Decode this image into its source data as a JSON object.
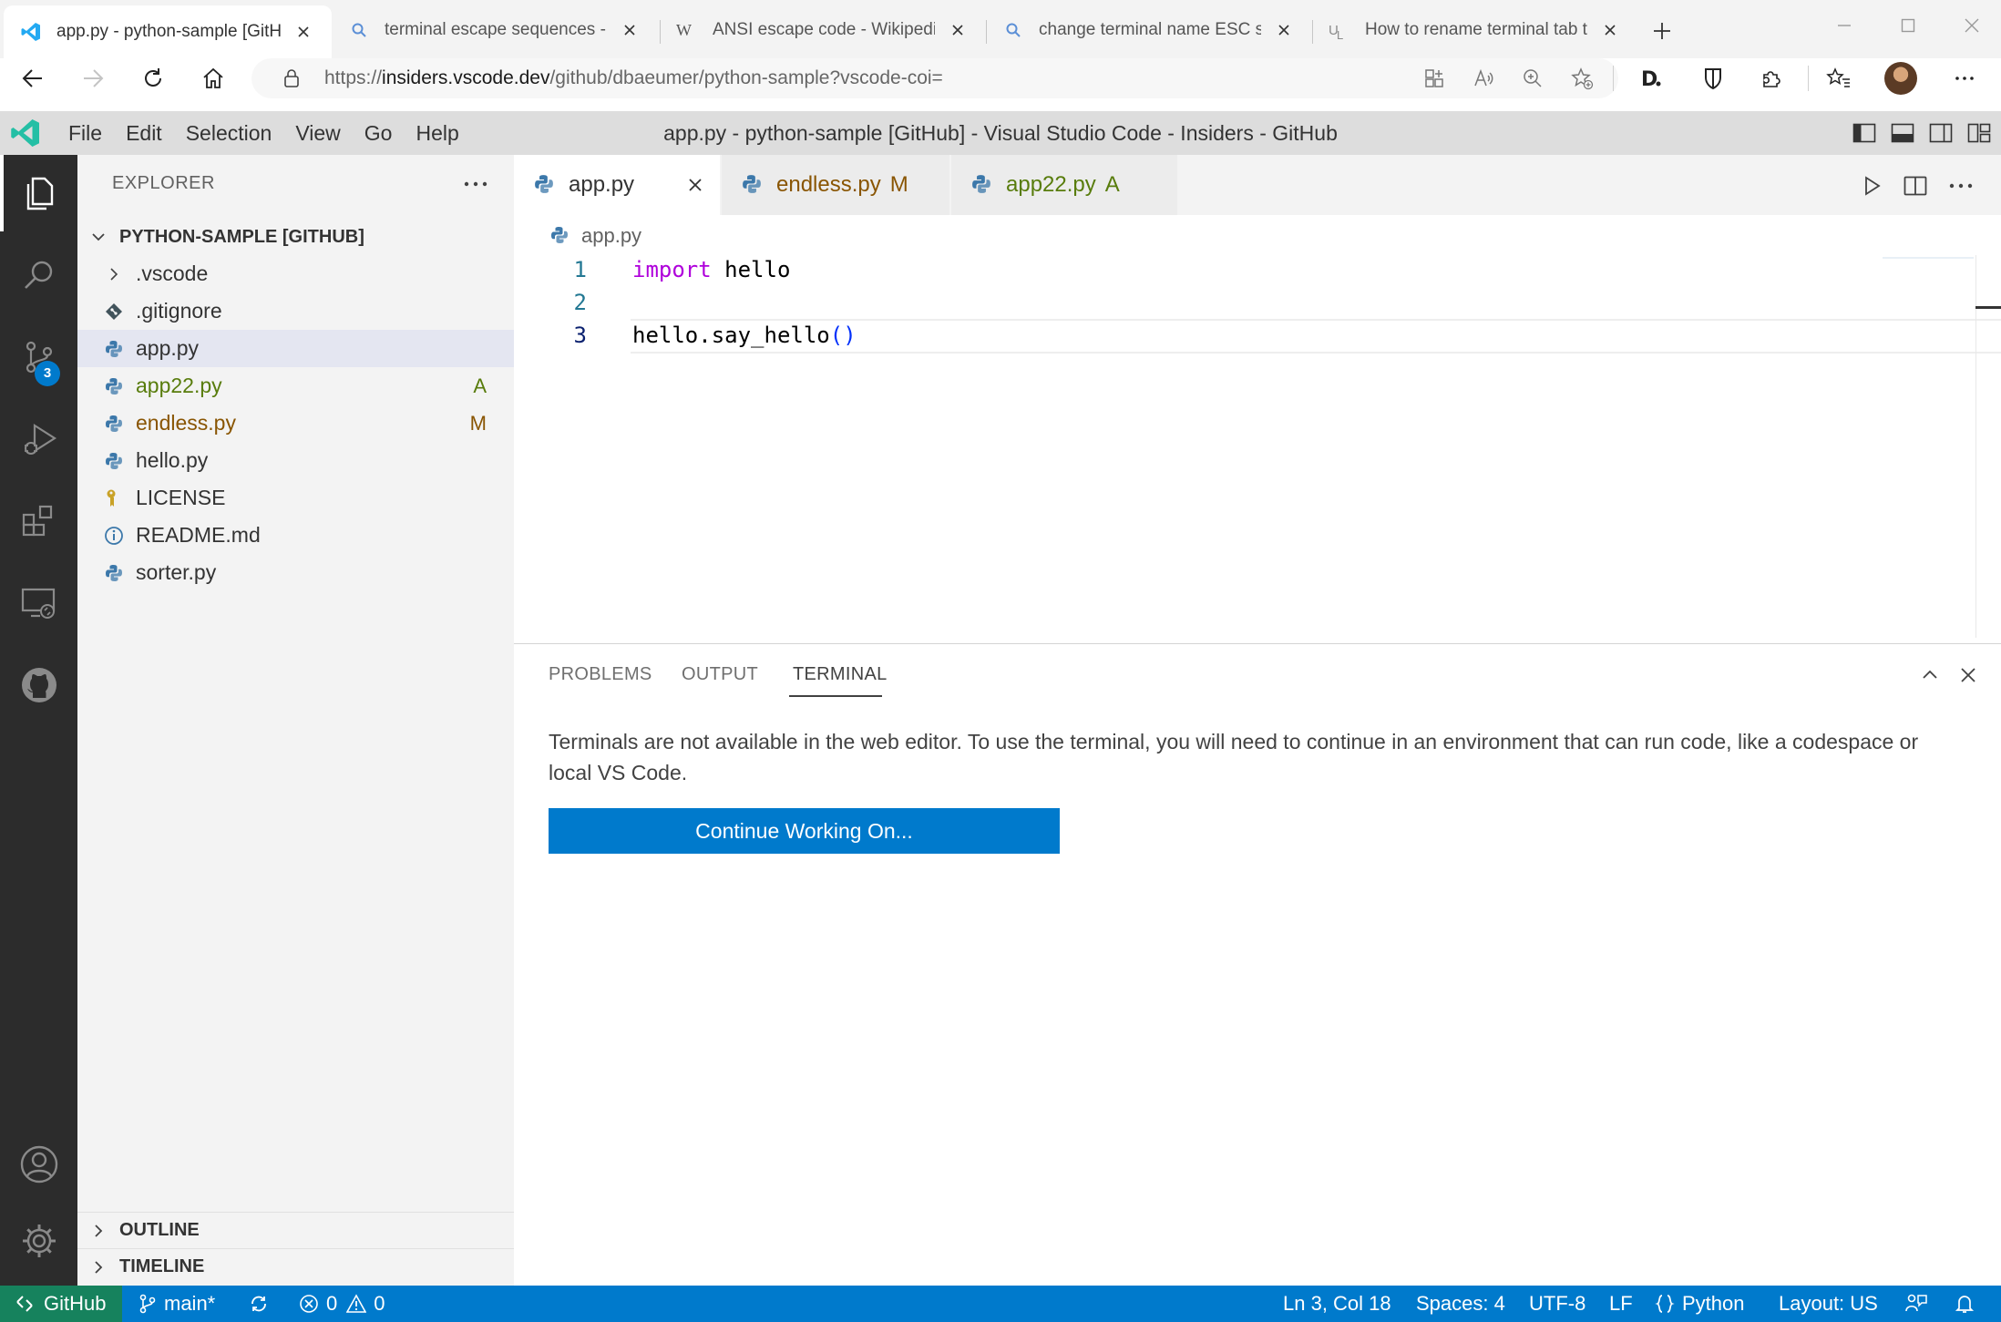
{
  "browser": {
    "tabs": [
      {
        "title": "app.py - python-sample [GitHub]",
        "icon": "vscode-icon",
        "active": true
      },
      {
        "title": "terminal escape sequences - Sea",
        "icon": "search-icon"
      },
      {
        "title": "ANSI escape code - Wikipedia",
        "icon": "wikipedia-icon"
      },
      {
        "title": "change terminal name ESC seque",
        "icon": "search-icon"
      },
      {
        "title": "How to rename terminal tab title",
        "icon": "unix-linux-icon"
      }
    ],
    "url_prefix": "https://",
    "url_host": "insiders.vscode.dev",
    "url_path": "/github/dbaeumer/python-sample?vscode-coi="
  },
  "titlebar": {
    "menu": [
      "File",
      "Edit",
      "Selection",
      "View",
      "Go",
      "Help"
    ],
    "window_title": "app.py - python-sample [GitHub] - Visual Studio Code - Insiders - GitHub"
  },
  "activity": {
    "scm_badge": "3"
  },
  "sidebar": {
    "header": "EXPLORER",
    "root": "PYTHON-SAMPLE [GITHUB]",
    "items": [
      {
        "name": ".vscode",
        "type": "folder"
      },
      {
        "name": ".gitignore",
        "type": "git"
      },
      {
        "name": "app.py",
        "type": "python",
        "selected": true
      },
      {
        "name": "app22.py",
        "type": "python",
        "status": "A"
      },
      {
        "name": "endless.py",
        "type": "python",
        "status": "M"
      },
      {
        "name": "hello.py",
        "type": "python"
      },
      {
        "name": "LICENSE",
        "type": "license"
      },
      {
        "name": "README.md",
        "type": "info"
      },
      {
        "name": "sorter.py",
        "type": "python"
      }
    ],
    "outline": "OUTLINE",
    "timeline": "TIMELINE"
  },
  "editor": {
    "tabs": [
      {
        "label": "app.py",
        "status": ""
      },
      {
        "label": "endless.py",
        "status": "M"
      },
      {
        "label": "app22.py",
        "status": "A"
      }
    ],
    "breadcrumb": "app.py",
    "lines": [
      {
        "n": "1",
        "kw": "import",
        "rest": " hello"
      },
      {
        "n": "2",
        "text": ""
      },
      {
        "n": "3",
        "call": "hello.say_hello",
        "paren": "()"
      }
    ]
  },
  "panel": {
    "tabs": [
      "PROBLEMS",
      "OUTPUT",
      "TERMINAL"
    ],
    "message": "Terminals are not available in the web editor. To use the terminal, you will need to continue in an environment that can run code, like a codespace or local VS Code.",
    "button": "Continue Working On..."
  },
  "status": {
    "remote": "GitHub",
    "branch": "main*",
    "errors": "0",
    "warnings": "0",
    "position": "Ln 3, Col 18",
    "spaces": "Spaces: 4",
    "encoding": "UTF-8",
    "eol": "LF",
    "language": "Python",
    "layout": "Layout: US"
  },
  "colors": {
    "accent": "#007acc",
    "remote": "#16825d",
    "added": "#587c0c",
    "modified": "#895503"
  }
}
